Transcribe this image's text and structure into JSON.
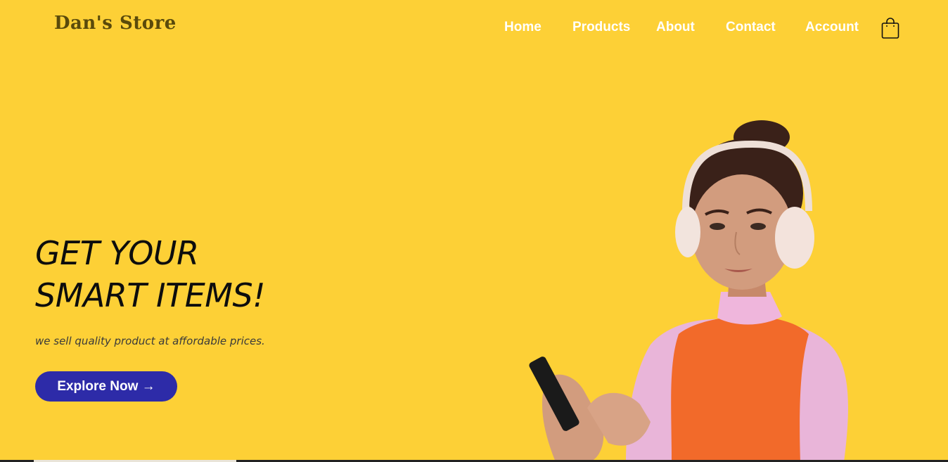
{
  "brand": {
    "name": "Dan's Store"
  },
  "nav": {
    "items": [
      {
        "label": "Home"
      },
      {
        "label": "Products"
      },
      {
        "label": "About"
      },
      {
        "label": "Contact"
      },
      {
        "label": "Account"
      }
    ],
    "cart_icon": "shopping-bag-icon"
  },
  "hero": {
    "title_line1": "GET YOUR",
    "title_line2": "SMART ITEMS!",
    "subtitle": "we sell quality product at affordable prices.",
    "cta_label": "Explore Now →"
  },
  "colors": {
    "background": "#FDD036",
    "cta": "#2D2BA8",
    "nav_text": "#FFFFFF",
    "title_text": "#0D0D0D"
  }
}
